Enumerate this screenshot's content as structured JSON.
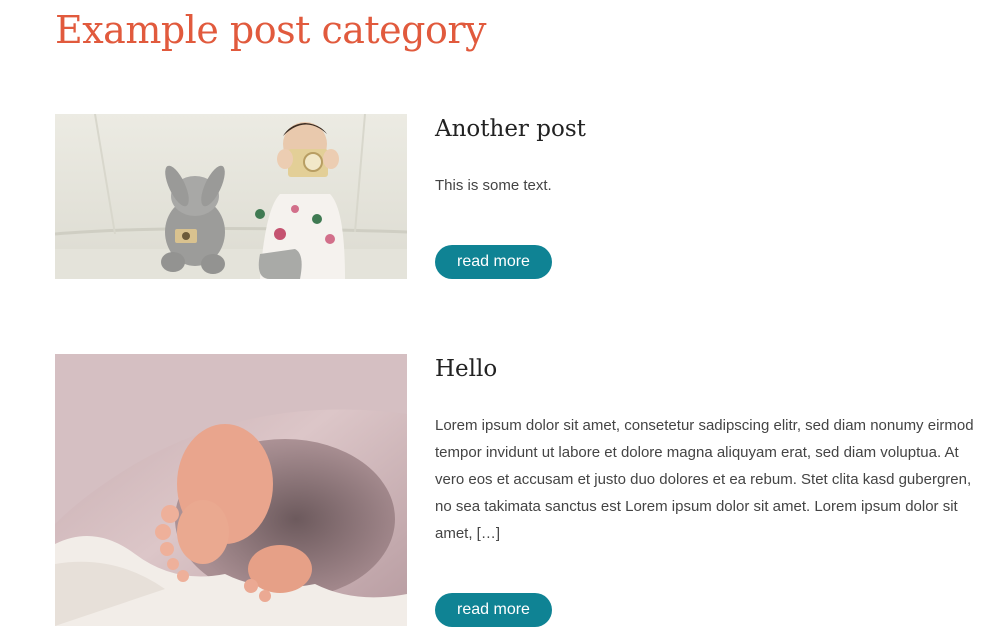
{
  "category": {
    "title": "Example post category",
    "title_color": "#e15a3d"
  },
  "posts": [
    {
      "title": "Another post",
      "excerpt": "This is some text.",
      "read_more_label": "read more",
      "thumbnail": "photo of child with toy camera and stuffed bunny"
    },
    {
      "title": "Hello",
      "excerpt": "Lorem ipsum dolor sit amet, consetetur sadipscing elitr, sed diam nonumy eirmod tempor invidunt ut labore et dolore magna aliquyam erat, sed diam voluptua. At vero eos et accusam et justo duo dolores et ea rebum. Stet clita kasd gubergren, no sea takimata sanctus est Lorem ipsum dolor sit amet. Lorem ipsum dolor sit amet, […]",
      "read_more_label": "read more",
      "thumbnail": "photo of baby feet under pink blanket"
    }
  ],
  "colors": {
    "button": "#0f8394",
    "heading": "#222222",
    "body_text": "#444444"
  }
}
